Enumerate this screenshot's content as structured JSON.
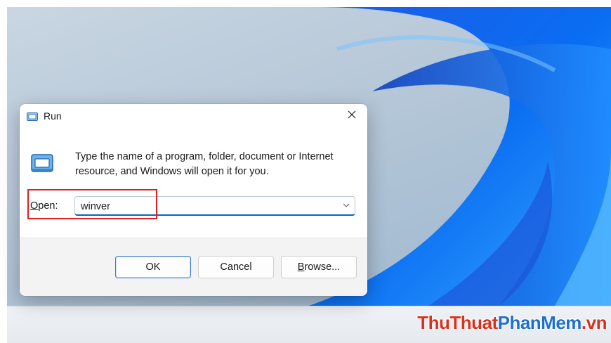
{
  "dialog": {
    "title": "Run",
    "description": "Type the name of a program, folder, document or Internet resource, and Windows will open it for you.",
    "open_label_first": "O",
    "open_label_rest": "pen:",
    "input_value": "winver",
    "buttons": {
      "ok": "OK",
      "cancel": "Cancel",
      "browse_first": "B",
      "browse_rest": "rowse..."
    }
  },
  "watermark": {
    "part1": "ThuThuat",
    "part2": "PhanMem",
    "part3": ".vn"
  },
  "colors": {
    "accent": "#0067c0",
    "highlight_box": "#e02020",
    "watermark_red": "#d9311f",
    "watermark_blue": "#1f6fd1"
  },
  "icons": {
    "title": "run-app-icon",
    "close": "close-icon",
    "large": "run-app-icon",
    "dropdown": "chevron-down-icon"
  }
}
